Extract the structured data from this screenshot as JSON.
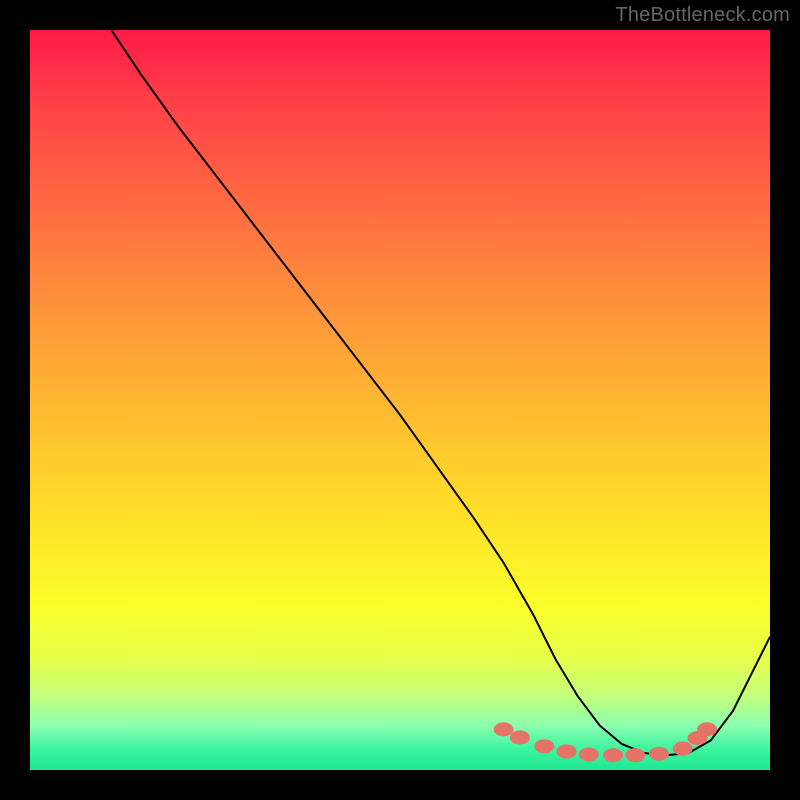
{
  "attribution": "TheBottleneck.com",
  "chart_data": {
    "type": "line",
    "title": "",
    "xlabel": "",
    "ylabel": "",
    "xlim": [
      0,
      100
    ],
    "ylim": [
      0,
      100
    ],
    "series": [
      {
        "name": "curve",
        "x": [
          11,
          15,
          20,
          25,
          30,
          35,
          40,
          45,
          50,
          55,
          60,
          64,
          68,
          71,
          74,
          77,
          80,
          83,
          86,
          89,
          92,
          95,
          100
        ],
        "y": [
          100,
          94,
          87,
          80.5,
          74,
          67.5,
          61,
          54.5,
          48,
          41,
          34,
          28,
          21,
          15,
          10,
          6,
          3.5,
          2.3,
          2.0,
          2.3,
          4,
          8,
          18
        ]
      }
    ],
    "markers": {
      "name": "dots",
      "x": [
        64.0,
        66.2,
        69.5,
        72.5,
        75.5,
        78.8,
        81.8,
        85.0,
        88.2,
        90.2,
        91.5
      ],
      "y": [
        5.5,
        4.4,
        3.2,
        2.5,
        2.1,
        2.0,
        2.0,
        2.2,
        2.9,
        4.3,
        5.5
      ]
    },
    "background_gradient": {
      "top": "#ff1a47",
      "mid": "#ffe628",
      "bottom": "#1ee890"
    }
  }
}
